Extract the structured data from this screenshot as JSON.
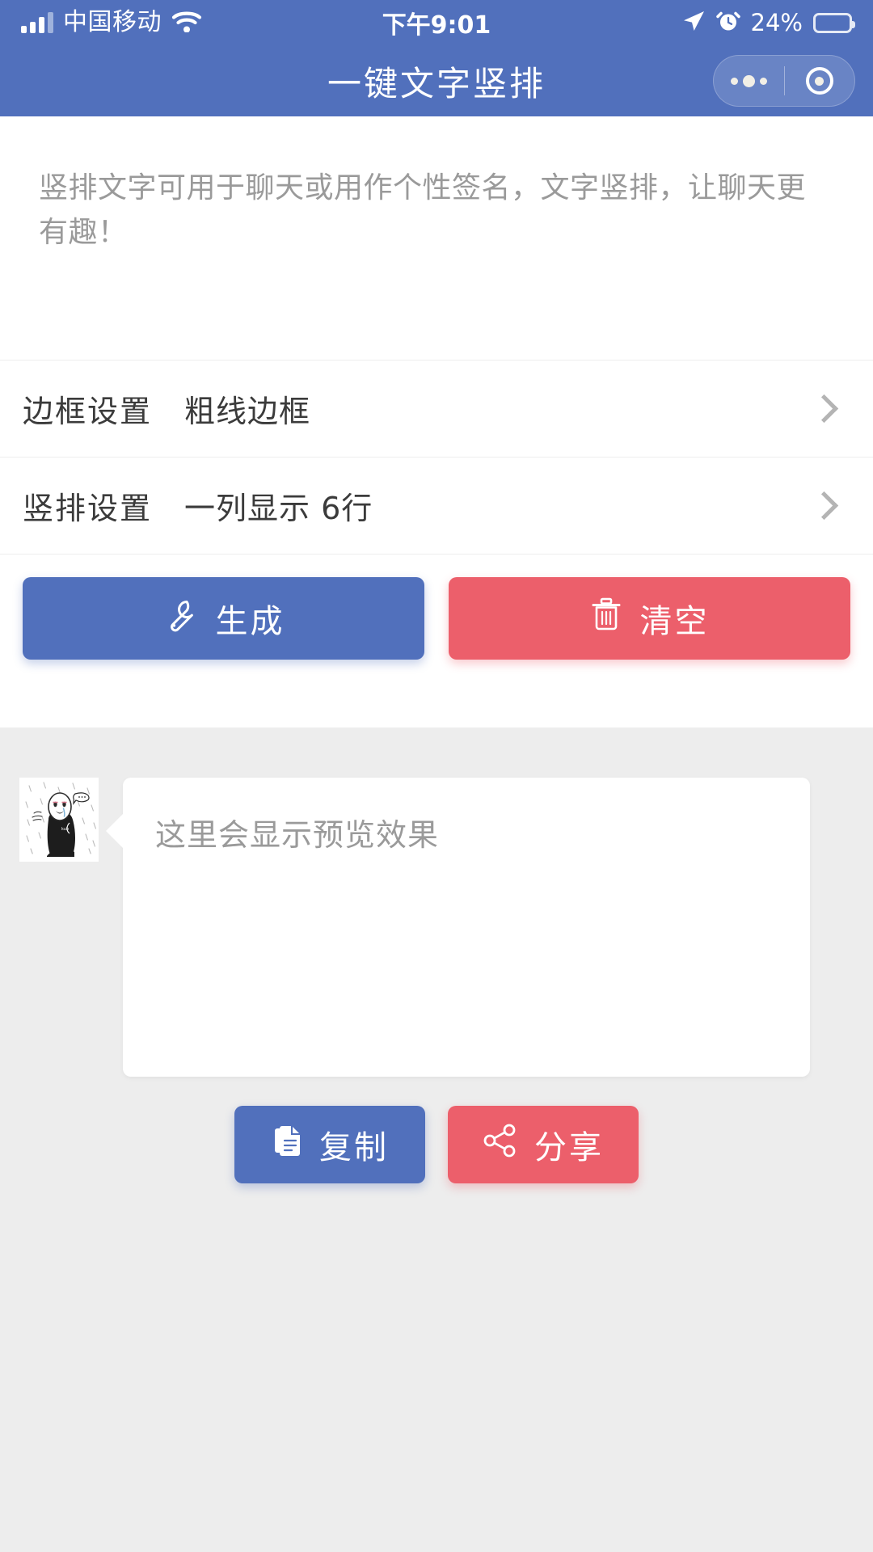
{
  "status_bar": {
    "carrier": "中国移动",
    "signal_icon": "signal-bars-icon",
    "wifi_icon": "wifi-icon",
    "time": "下午9:01",
    "location_icon": "location-arrow-icon",
    "alarm_icon": "alarm-clock-icon",
    "battery_percent": "24%",
    "battery_level": 24,
    "battery_icon": "battery-icon"
  },
  "nav_bar": {
    "title": "一键文字竖排",
    "capsule": {
      "menu_icon": "more-dots-icon",
      "close_icon": "target-circle-icon"
    }
  },
  "description": {
    "text": "竖排文字可用于聊天或用作个性签名，文字竖排，让聊天更有趣！"
  },
  "settings": {
    "rows": [
      {
        "label": "边框设置",
        "value": "粗线边框",
        "chevron_icon": "chevron-right-icon"
      },
      {
        "label": "竖排设置",
        "value": "一列显示 6行",
        "chevron_icon": "chevron-right-icon"
      }
    ]
  },
  "actions": {
    "generate": {
      "label": "生成",
      "icon": "wrench-icon"
    },
    "clear": {
      "label": "清空",
      "icon": "trash-icon"
    }
  },
  "preview": {
    "avatar_icon": "no-face-sticker-avatar",
    "placeholder": "这里会显示预览效果"
  },
  "share": {
    "copy": {
      "label": "复制",
      "icon": "document-copy-icon"
    },
    "share": {
      "label": "分享",
      "icon": "share-nodes-icon"
    }
  },
  "colors": {
    "brand_blue": "#5170bc",
    "accent_red": "#ec5f6b",
    "page_bg": "#ffffff",
    "preview_bg": "#ededed",
    "text_primary": "#3b3b3b",
    "text_muted": "#9a9a9a",
    "divider": "#eeeeee"
  }
}
